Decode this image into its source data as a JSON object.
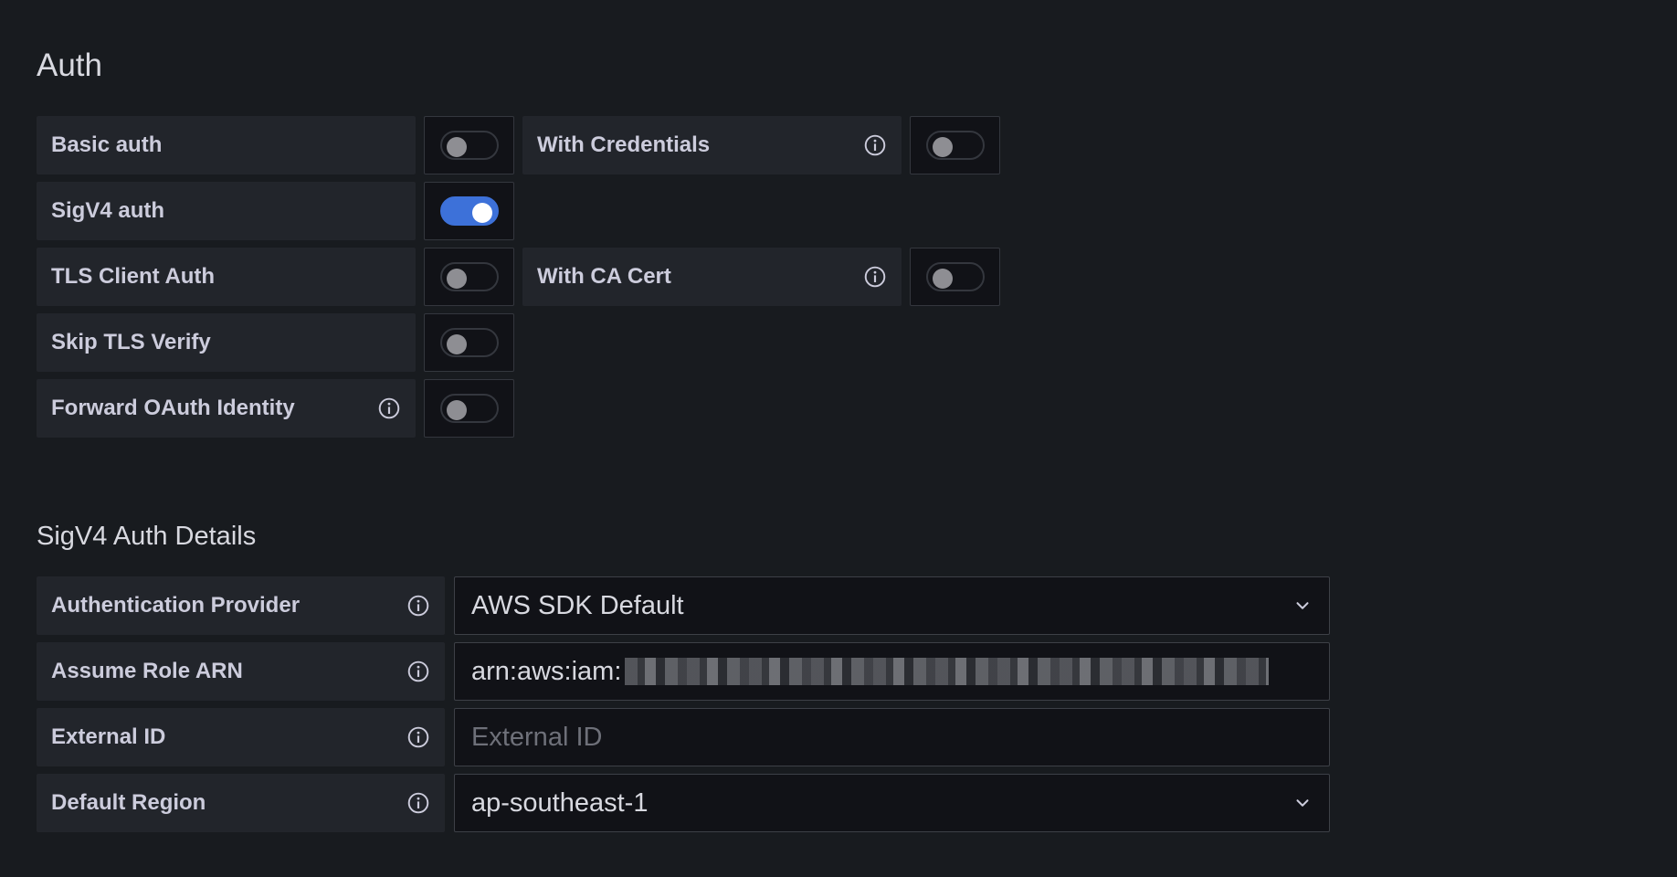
{
  "auth": {
    "title": "Auth",
    "basic_auth": {
      "label": "Basic auth",
      "enabled": false
    },
    "with_credentials": {
      "label": "With Credentials",
      "enabled": false
    },
    "sigv4_auth": {
      "label": "SigV4 auth",
      "enabled": true
    },
    "tls_client_auth": {
      "label": "TLS Client Auth",
      "enabled": false
    },
    "with_ca_cert": {
      "label": "With CA Cert",
      "enabled": false
    },
    "skip_tls_verify": {
      "label": "Skip TLS Verify",
      "enabled": false
    },
    "forward_oauth": {
      "label": "Forward OAuth Identity",
      "enabled": false
    }
  },
  "sigv4": {
    "title": "SigV4 Auth Details",
    "auth_provider": {
      "label": "Authentication Provider",
      "value": "AWS SDK Default"
    },
    "assume_role_arn": {
      "label": "Assume Role ARN",
      "value": "arn:aws:iam:"
    },
    "external_id": {
      "label": "External ID",
      "placeholder": "External ID"
    },
    "default_region": {
      "label": "Default Region",
      "value": "ap-southeast-1"
    }
  },
  "colors": {
    "background": "#181b1f",
    "label_bg": "#22252b",
    "input_bg": "#111217",
    "toggle_on": "#3d71d9"
  },
  "icons": {
    "info": "info-circle-icon",
    "dropdown": "chevron-down-icon"
  }
}
